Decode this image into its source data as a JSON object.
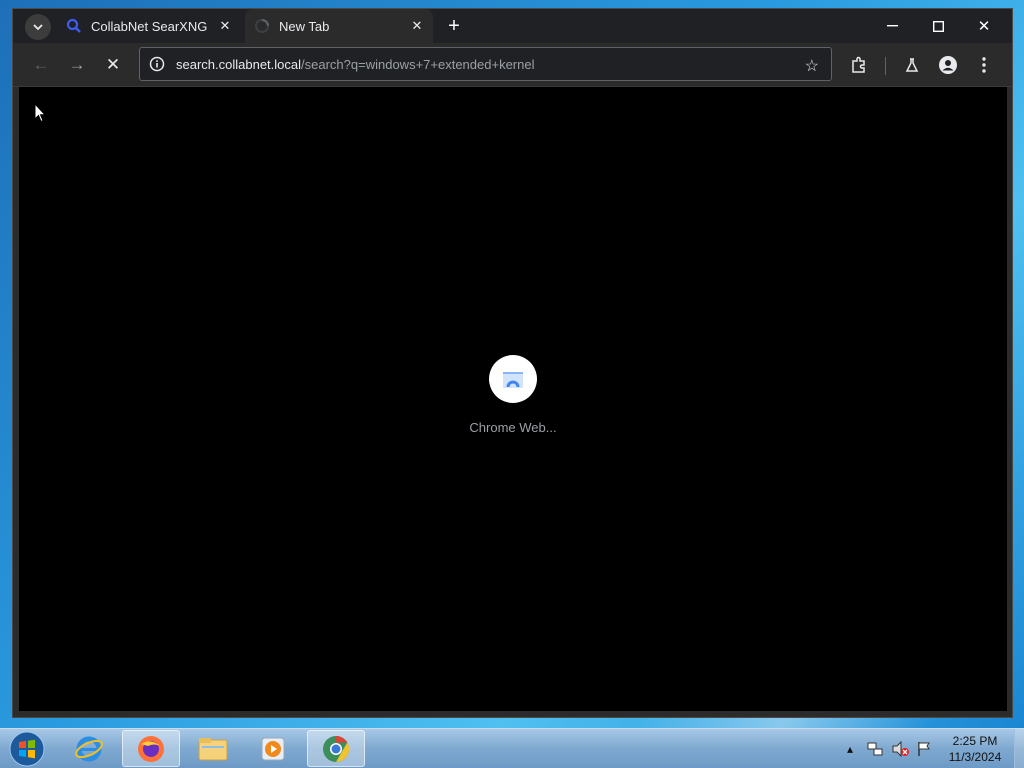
{
  "browser": {
    "tabs": [
      {
        "title": "CollabNet SearXNG",
        "favicon": "search-icon",
        "active": false
      },
      {
        "title": "New Tab",
        "favicon": "loading-spinner-icon",
        "active": true
      }
    ],
    "address_bar": {
      "host": "search.collabnet.local",
      "path": "/search?q=windows+7+extended+kernel"
    },
    "page": {
      "loading_label": "Chrome Web..."
    }
  },
  "taskbar": {
    "apps": [
      "internet-explorer-icon",
      "firefox-icon",
      "file-explorer-icon",
      "media-player-icon",
      "chrome-icon"
    ],
    "clock": {
      "time": "2:25 PM",
      "date": "11/3/2024"
    }
  }
}
